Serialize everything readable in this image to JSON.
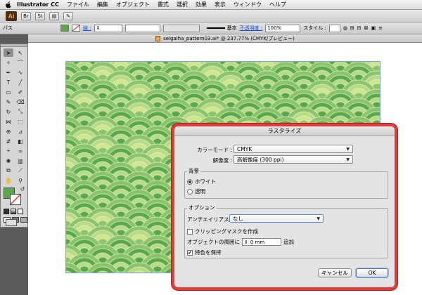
{
  "menubar": {
    "app": "Illustrator CC",
    "items": [
      "ファイル",
      "編集",
      "オブジェクト",
      "書式",
      "選択",
      "効果",
      "表示",
      "ウィンドウ",
      "ヘルプ"
    ]
  },
  "appbar": {
    "logo": "Ai"
  },
  "control": {
    "label": "パス",
    "stroke_label": "線 :",
    "stroke_style": "基本",
    "opacity_label": "不透明度 :",
    "opacity_value": "100%",
    "style_label": "スタイル :"
  },
  "document": {
    "tab_title": "seigaiha_pattern03.ai* @ 237.77% (CMYK/プレビュー)"
  },
  "colors": {
    "pattern_dark": "#2f8f38",
    "pattern_light": "#cfe68a",
    "pattern_mid": "#59a84a",
    "highlight": "#e33a3a"
  },
  "dialog": {
    "title": "ラスタライズ",
    "color_mode_label": "カラーモード :",
    "color_mode_value": "CMYK",
    "resolution_label": "解像度 :",
    "resolution_value": "高解像度 (300 ppi)",
    "background_title": "背景",
    "bg_white": "ホワイト",
    "bg_transparent": "透明",
    "options_title": "オプション",
    "antialias_label": "アンチエイリアス :",
    "antialias_value": "なし",
    "clipping_mask": "クリッピングマスクを作成",
    "padding_label": "オブジェクトの周囲に",
    "padding_value": "0 mm",
    "padding_suffix": "追加",
    "preserve_spot": "特色を保持",
    "cancel": "キャンセル",
    "ok": "OK"
  }
}
